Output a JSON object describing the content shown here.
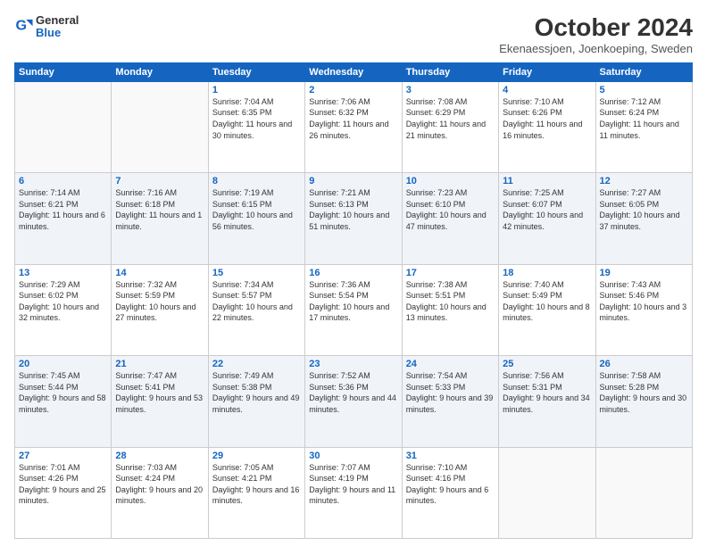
{
  "logo": {
    "general": "General",
    "blue": "Blue"
  },
  "title": "October 2024",
  "subtitle": "Ekenaessjoen, Joenkoeping, Sweden",
  "headers": [
    "Sunday",
    "Monday",
    "Tuesday",
    "Wednesday",
    "Thursday",
    "Friday",
    "Saturday"
  ],
  "weeks": [
    [
      {
        "day": "",
        "info": ""
      },
      {
        "day": "",
        "info": ""
      },
      {
        "day": "1",
        "info": "Sunrise: 7:04 AM\nSunset: 6:35 PM\nDaylight: 11 hours and 30 minutes."
      },
      {
        "day": "2",
        "info": "Sunrise: 7:06 AM\nSunset: 6:32 PM\nDaylight: 11 hours and 26 minutes."
      },
      {
        "day": "3",
        "info": "Sunrise: 7:08 AM\nSunset: 6:29 PM\nDaylight: 11 hours and 21 minutes."
      },
      {
        "day": "4",
        "info": "Sunrise: 7:10 AM\nSunset: 6:26 PM\nDaylight: 11 hours and 16 minutes."
      },
      {
        "day": "5",
        "info": "Sunrise: 7:12 AM\nSunset: 6:24 PM\nDaylight: 11 hours and 11 minutes."
      }
    ],
    [
      {
        "day": "6",
        "info": "Sunrise: 7:14 AM\nSunset: 6:21 PM\nDaylight: 11 hours and 6 minutes."
      },
      {
        "day": "7",
        "info": "Sunrise: 7:16 AM\nSunset: 6:18 PM\nDaylight: 11 hours and 1 minute."
      },
      {
        "day": "8",
        "info": "Sunrise: 7:19 AM\nSunset: 6:15 PM\nDaylight: 10 hours and 56 minutes."
      },
      {
        "day": "9",
        "info": "Sunrise: 7:21 AM\nSunset: 6:13 PM\nDaylight: 10 hours and 51 minutes."
      },
      {
        "day": "10",
        "info": "Sunrise: 7:23 AM\nSunset: 6:10 PM\nDaylight: 10 hours and 47 minutes."
      },
      {
        "day": "11",
        "info": "Sunrise: 7:25 AM\nSunset: 6:07 PM\nDaylight: 10 hours and 42 minutes."
      },
      {
        "day": "12",
        "info": "Sunrise: 7:27 AM\nSunset: 6:05 PM\nDaylight: 10 hours and 37 minutes."
      }
    ],
    [
      {
        "day": "13",
        "info": "Sunrise: 7:29 AM\nSunset: 6:02 PM\nDaylight: 10 hours and 32 minutes."
      },
      {
        "day": "14",
        "info": "Sunrise: 7:32 AM\nSunset: 5:59 PM\nDaylight: 10 hours and 27 minutes."
      },
      {
        "day": "15",
        "info": "Sunrise: 7:34 AM\nSunset: 5:57 PM\nDaylight: 10 hours and 22 minutes."
      },
      {
        "day": "16",
        "info": "Sunrise: 7:36 AM\nSunset: 5:54 PM\nDaylight: 10 hours and 17 minutes."
      },
      {
        "day": "17",
        "info": "Sunrise: 7:38 AM\nSunset: 5:51 PM\nDaylight: 10 hours and 13 minutes."
      },
      {
        "day": "18",
        "info": "Sunrise: 7:40 AM\nSunset: 5:49 PM\nDaylight: 10 hours and 8 minutes."
      },
      {
        "day": "19",
        "info": "Sunrise: 7:43 AM\nSunset: 5:46 PM\nDaylight: 10 hours and 3 minutes."
      }
    ],
    [
      {
        "day": "20",
        "info": "Sunrise: 7:45 AM\nSunset: 5:44 PM\nDaylight: 9 hours and 58 minutes."
      },
      {
        "day": "21",
        "info": "Sunrise: 7:47 AM\nSunset: 5:41 PM\nDaylight: 9 hours and 53 minutes."
      },
      {
        "day": "22",
        "info": "Sunrise: 7:49 AM\nSunset: 5:38 PM\nDaylight: 9 hours and 49 minutes."
      },
      {
        "day": "23",
        "info": "Sunrise: 7:52 AM\nSunset: 5:36 PM\nDaylight: 9 hours and 44 minutes."
      },
      {
        "day": "24",
        "info": "Sunrise: 7:54 AM\nSunset: 5:33 PM\nDaylight: 9 hours and 39 minutes."
      },
      {
        "day": "25",
        "info": "Sunrise: 7:56 AM\nSunset: 5:31 PM\nDaylight: 9 hours and 34 minutes."
      },
      {
        "day": "26",
        "info": "Sunrise: 7:58 AM\nSunset: 5:28 PM\nDaylight: 9 hours and 30 minutes."
      }
    ],
    [
      {
        "day": "27",
        "info": "Sunrise: 7:01 AM\nSunset: 4:26 PM\nDaylight: 9 hours and 25 minutes."
      },
      {
        "day": "28",
        "info": "Sunrise: 7:03 AM\nSunset: 4:24 PM\nDaylight: 9 hours and 20 minutes."
      },
      {
        "day": "29",
        "info": "Sunrise: 7:05 AM\nSunset: 4:21 PM\nDaylight: 9 hours and 16 minutes."
      },
      {
        "day": "30",
        "info": "Sunrise: 7:07 AM\nSunset: 4:19 PM\nDaylight: 9 hours and 11 minutes."
      },
      {
        "day": "31",
        "info": "Sunrise: 7:10 AM\nSunset: 4:16 PM\nDaylight: 9 hours and 6 minutes."
      },
      {
        "day": "",
        "info": ""
      },
      {
        "day": "",
        "info": ""
      }
    ]
  ]
}
